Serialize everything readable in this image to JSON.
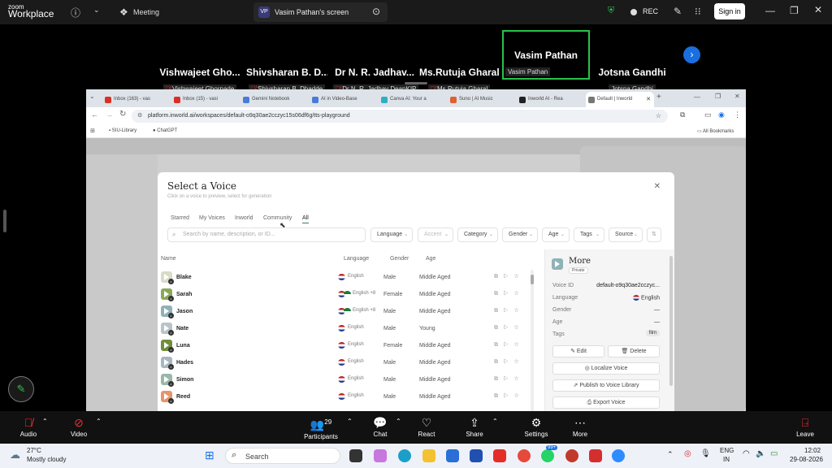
{
  "zoom": {
    "brand_top": "zoom",
    "brand_bottom": "Workplace",
    "meeting_label": "Meeting",
    "share_badge": "VP",
    "share_title": "Vasim Pathan's screen",
    "rec_label": "REC",
    "sign_in": "Sign in"
  },
  "participants": [
    {
      "name": "Vishwajeet  Gho...",
      "label": "Vishwajeet Ghorpade",
      "muted": true
    },
    {
      "name": "Shivsharan  B.  D...",
      "label": "Shivsharan B. Dhadde",
      "muted": true
    },
    {
      "name": "Dr  N.  R.  Jadhav...",
      "label": "Dr N. R. Jadhav DeanKIP",
      "muted": true
    },
    {
      "name": "Ms.Rutuja Gharal",
      "label": "Ms.Rutuja Gharal",
      "muted": true
    },
    {
      "name": "Vasim Pathan",
      "label": "Vasim Pathan",
      "muted": false,
      "active": true
    },
    {
      "name": "Jotsna Gandhi",
      "label": "Jotsna Gandhi",
      "muted": false
    }
  ],
  "browser": {
    "tabs": [
      {
        "label": "Inbox (163) - vas",
        "color": "#d93025"
      },
      {
        "label": "Inbox (15) - vasi",
        "color": "#d93025"
      },
      {
        "label": "Gemini Notebook",
        "color": "#4a7bd8"
      },
      {
        "label": "AI in Video-Base",
        "color": "#4a7bd8"
      },
      {
        "label": "Canva AI: Your a",
        "color": "#2bb0c0"
      },
      {
        "label": "Suno | AI Music",
        "color": "#e06030"
      },
      {
        "label": "Inworld AI - Rea",
        "color": "#222222"
      },
      {
        "label": "Default | Inworld",
        "color": "#777777",
        "active": true
      }
    ],
    "url": "platform.inworld.ai/workspaces/default-o9q30ae2cczyc15s06df6g/tts-playground",
    "bookmarks": [
      "SIU-Library",
      "ChatGPT"
    ],
    "all_bookmarks": "All Bookmarks"
  },
  "modal": {
    "title": "Select a Voice",
    "subtitle": "Click on a voice to preview, select for generation",
    "filter_tabs": [
      "Starred",
      "My Voices",
      "Inworld",
      "Community",
      "All"
    ],
    "selected_tab": "All",
    "search_placeholder": "Search by name, description, or ID...",
    "dropdowns": [
      "Language",
      "Accent",
      "Category",
      "Gender",
      "Age",
      "Tags",
      "Source"
    ],
    "columns": {
      "name": "Name",
      "language": "Language",
      "gender": "Gender",
      "age": "Age"
    },
    "voices": [
      {
        "name": "Blake",
        "language": "English",
        "extra_flag": false,
        "gender": "Male",
        "age": "Middle Aged",
        "color": "#d8dcc8"
      },
      {
        "name": "Sarah",
        "language": "English +8",
        "extra_flag": true,
        "gender": "Female",
        "age": "Middle Aged",
        "color": "#8aa85a"
      },
      {
        "name": "Jason",
        "language": "English +8",
        "extra_flag": true,
        "gender": "Male",
        "age": "Middle Aged",
        "color": "#8fb2b8"
      },
      {
        "name": "Nate",
        "language": "English",
        "extra_flag": false,
        "gender": "Male",
        "age": "Young",
        "color": "#b8c4c8"
      },
      {
        "name": "Luna",
        "language": "English",
        "extra_flag": false,
        "gender": "Female",
        "age": "Middle Aged",
        "color": "#6f8f3a"
      },
      {
        "name": "Hades",
        "language": "English",
        "extra_flag": false,
        "gender": "Male",
        "age": "Middle Aged",
        "color": "#a8b8c0"
      },
      {
        "name": "Simon",
        "language": "English",
        "extra_flag": false,
        "gender": "Male",
        "age": "Middle Aged",
        "color": "#9ab8a8"
      },
      {
        "name": "Reed",
        "language": "English",
        "extra_flag": false,
        "gender": "Male",
        "age": "Middle Aged",
        "color": "#e8946a"
      }
    ],
    "detail": {
      "title": "More",
      "badge": "Private",
      "voice_id_label": "Voice ID",
      "voice_id": "default-o9q30ae2cczyc...",
      "language_label": "Language",
      "language": "English",
      "gender_label": "Gender",
      "gender": "—",
      "age_label": "Age",
      "age": "—",
      "tags_label": "Tags",
      "tags": "film",
      "edit": "Edit",
      "delete": "Delete",
      "localize": "Localize Voice",
      "publish": "Publish to Voice Library",
      "export": "Export Voice"
    }
  },
  "toolbar": {
    "audio": "Audio",
    "video": "Video",
    "participants": "Participants",
    "participants_count": "29",
    "chat": "Chat",
    "react": "React",
    "share": "Share",
    "settings": "Settings",
    "more": "More",
    "leave": "Leave"
  },
  "taskbar": {
    "temp": "27°C",
    "weather": "Mostly cloudy",
    "search": "Search",
    "badge": "99+",
    "lang_top": "ENG",
    "lang_bottom": "IN",
    "time": "12:02",
    "date": "29-08-2026"
  }
}
